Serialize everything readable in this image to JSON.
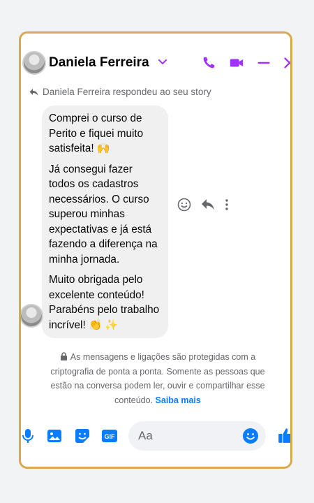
{
  "header": {
    "contact_name": "Daniela Ferreira",
    "icons": [
      "chevron-down-icon",
      "phone-icon",
      "video-icon",
      "minimize-icon",
      "close-icon"
    ],
    "accent_color": "#a033ff"
  },
  "story_reply": "Daniela Ferreira respondeu ao seu story",
  "message": {
    "paragraphs": [
      "Comprei o curso de Perito e fiquei muito satisfeita! 🙌",
      "Já consegui fazer todos os cadastros necessários. O curso superou minhas expectativas e já está fazendo a diferença na minha jornada.",
      "Muito obrigada pelo excelente conteúdo! Parabéns pelo trabalho incrível! 👏 ✨"
    ]
  },
  "encryption_notice": {
    "text": "As mensagens e ligações são protegidas com a criptografia de ponta a ponta. Somente as pessoas que estão na conversa podem ler, ouvir e compartilhar esse conteúdo.",
    "link": "Saiba mais"
  },
  "composer": {
    "placeholder": "Aa",
    "link_color": "#0a7cff"
  }
}
